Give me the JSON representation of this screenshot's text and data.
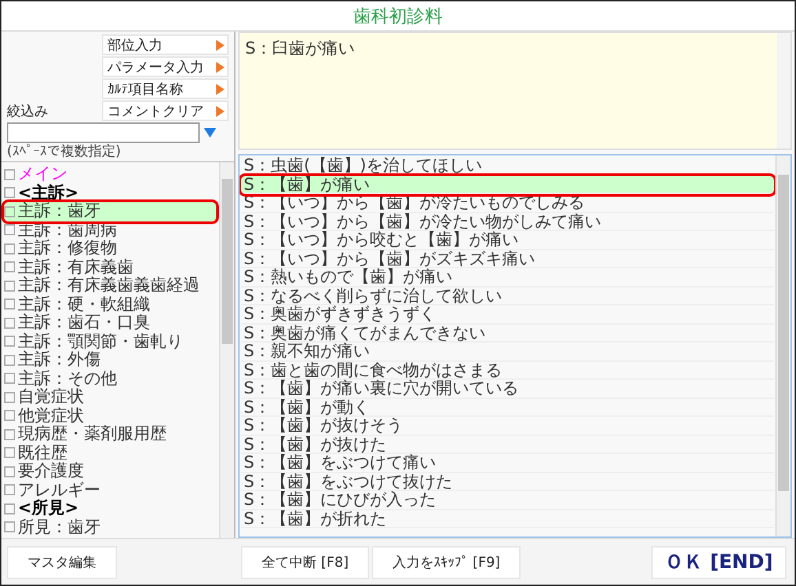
{
  "window": {
    "title": "歯科初診料"
  },
  "tool_buttons": [
    {
      "label": "部位入力"
    },
    {
      "label": "パラメータ入力"
    },
    {
      "label": "ｶﾙﾃ項目名称"
    },
    {
      "label": "コメントクリア"
    }
  ],
  "filter": {
    "label": "絞込み",
    "hint": "(ｽﾍﾟｰｽで複数指定)"
  },
  "memo": {
    "value": "S：臼歯が痛い"
  },
  "categories": [
    {
      "kind": "main",
      "label": "メイン",
      "checked": false,
      "selected": false
    },
    {
      "kind": "heading",
      "label": "<主訴>",
      "checked": false,
      "selected": false
    },
    {
      "kind": "item",
      "label": "主訴：歯牙",
      "checked": false,
      "selected": true
    },
    {
      "kind": "item",
      "label": "主訴：歯周病",
      "checked": false,
      "selected": false
    },
    {
      "kind": "item",
      "label": "主訴：修復物",
      "checked": false,
      "selected": false
    },
    {
      "kind": "item",
      "label": "主訴：有床義歯",
      "checked": false,
      "selected": false
    },
    {
      "kind": "item",
      "label": "主訴：有床義歯義歯経過",
      "checked": false,
      "selected": false
    },
    {
      "kind": "item",
      "label": "主訴：硬・軟組織",
      "checked": false,
      "selected": false
    },
    {
      "kind": "item",
      "label": "主訴：歯石・口臭",
      "checked": false,
      "selected": false
    },
    {
      "kind": "item",
      "label": "主訴：顎関節・歯軋り",
      "checked": false,
      "selected": false
    },
    {
      "kind": "item",
      "label": "主訴：外傷",
      "checked": false,
      "selected": false
    },
    {
      "kind": "item",
      "label": "主訴：その他",
      "checked": false,
      "selected": false
    },
    {
      "kind": "item",
      "label": "自覚症状",
      "checked": false,
      "selected": false
    },
    {
      "kind": "item",
      "label": "他覚症状",
      "checked": false,
      "selected": false
    },
    {
      "kind": "item",
      "label": "現病歴・薬剤服用歴",
      "checked": false,
      "selected": false
    },
    {
      "kind": "item",
      "label": "既往歴",
      "checked": false,
      "selected": false
    },
    {
      "kind": "item",
      "label": "要介護度",
      "checked": false,
      "selected": false
    },
    {
      "kind": "item",
      "label": "アレルギー",
      "checked": false,
      "selected": false
    },
    {
      "kind": "heading",
      "label": "<所見>",
      "checked": false,
      "selected": false
    },
    {
      "kind": "item",
      "label": "所見：歯牙",
      "checked": false,
      "selected": false
    }
  ],
  "phrases": [
    {
      "label": "S：虫歯(【歯】)を治してほしい",
      "selected": false
    },
    {
      "label": "S：【歯】が痛い",
      "selected": true
    },
    {
      "label": "S：【いつ】から【歯】が冷たいものでしみる",
      "selected": false
    },
    {
      "label": "S：【いつ】から【歯】が冷たい物がしみて痛い",
      "selected": false
    },
    {
      "label": "S：【いつ】から咬むと【歯】が痛い",
      "selected": false
    },
    {
      "label": "S：【いつ】から【歯】がズキズキ痛い",
      "selected": false
    },
    {
      "label": "S：熱いもので【歯】が痛い",
      "selected": false
    },
    {
      "label": "S：なるべく削らずに治して欲しい",
      "selected": false
    },
    {
      "label": "S：奥歯がずきずきうずく",
      "selected": false
    },
    {
      "label": "S：奥歯が痛くてがまんできない",
      "selected": false
    },
    {
      "label": "S：親不知が痛い",
      "selected": false
    },
    {
      "label": "S：歯と歯の間に食べ物がはさまる",
      "selected": false
    },
    {
      "label": "S：【歯】が痛い裏に穴が開いている",
      "selected": false
    },
    {
      "label": "S：【歯】が動く",
      "selected": false
    },
    {
      "label": "S：【歯】が抜けそう",
      "selected": false
    },
    {
      "label": "S：【歯】が抜けた",
      "selected": false
    },
    {
      "label": "S：【歯】をぶつけて痛い",
      "selected": false
    },
    {
      "label": "S：【歯】をぶつけて抜けた",
      "selected": false
    },
    {
      "label": "S：【歯】にひびが入った",
      "selected": false
    },
    {
      "label": "S：【歯】が折れた",
      "selected": false
    }
  ],
  "footer": {
    "master_edit": "マスタ編集",
    "cancel_all": "全て中断 [F8]",
    "skip_input": "入力をｽｷｯﾌﾟ [F9]",
    "ok": "ＯＫ [END]"
  }
}
